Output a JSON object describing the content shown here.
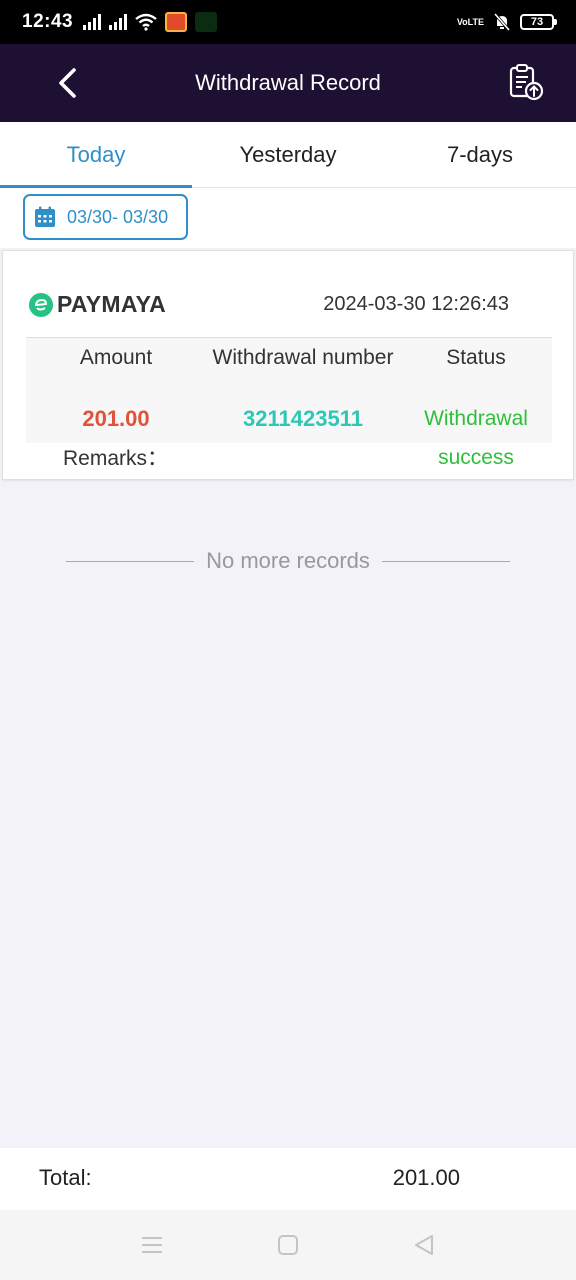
{
  "status_bar": {
    "time": "12:43",
    "network": "VoLTE",
    "battery": "73"
  },
  "header": {
    "title": "Withdrawal Record"
  },
  "tabs": [
    {
      "label": "Today",
      "active": true
    },
    {
      "label": "Yesterday",
      "active": false
    },
    {
      "label": "7-days",
      "active": false
    }
  ],
  "date_filter": {
    "range": "03/30- 03/30"
  },
  "records": [
    {
      "method": "PAYMAYA",
      "datetime": "2024-03-30 12:26:43",
      "headers": {
        "amount": "Amount",
        "number": "Withdrawal number",
        "status": "Status"
      },
      "amount": "201.00",
      "number": "3211423511",
      "status_line1": "Withdrawal",
      "status_line2": "success",
      "remarks_label": "Remarks："
    }
  ],
  "footer_note": "No more records",
  "total": {
    "label": "Total:",
    "value": "201.00"
  },
  "colors": {
    "header_bg": "#1e1033",
    "accent": "#2e8fc9",
    "amount": "#e0523a",
    "number": "#2ec7b5",
    "success": "#2fbf3a"
  }
}
